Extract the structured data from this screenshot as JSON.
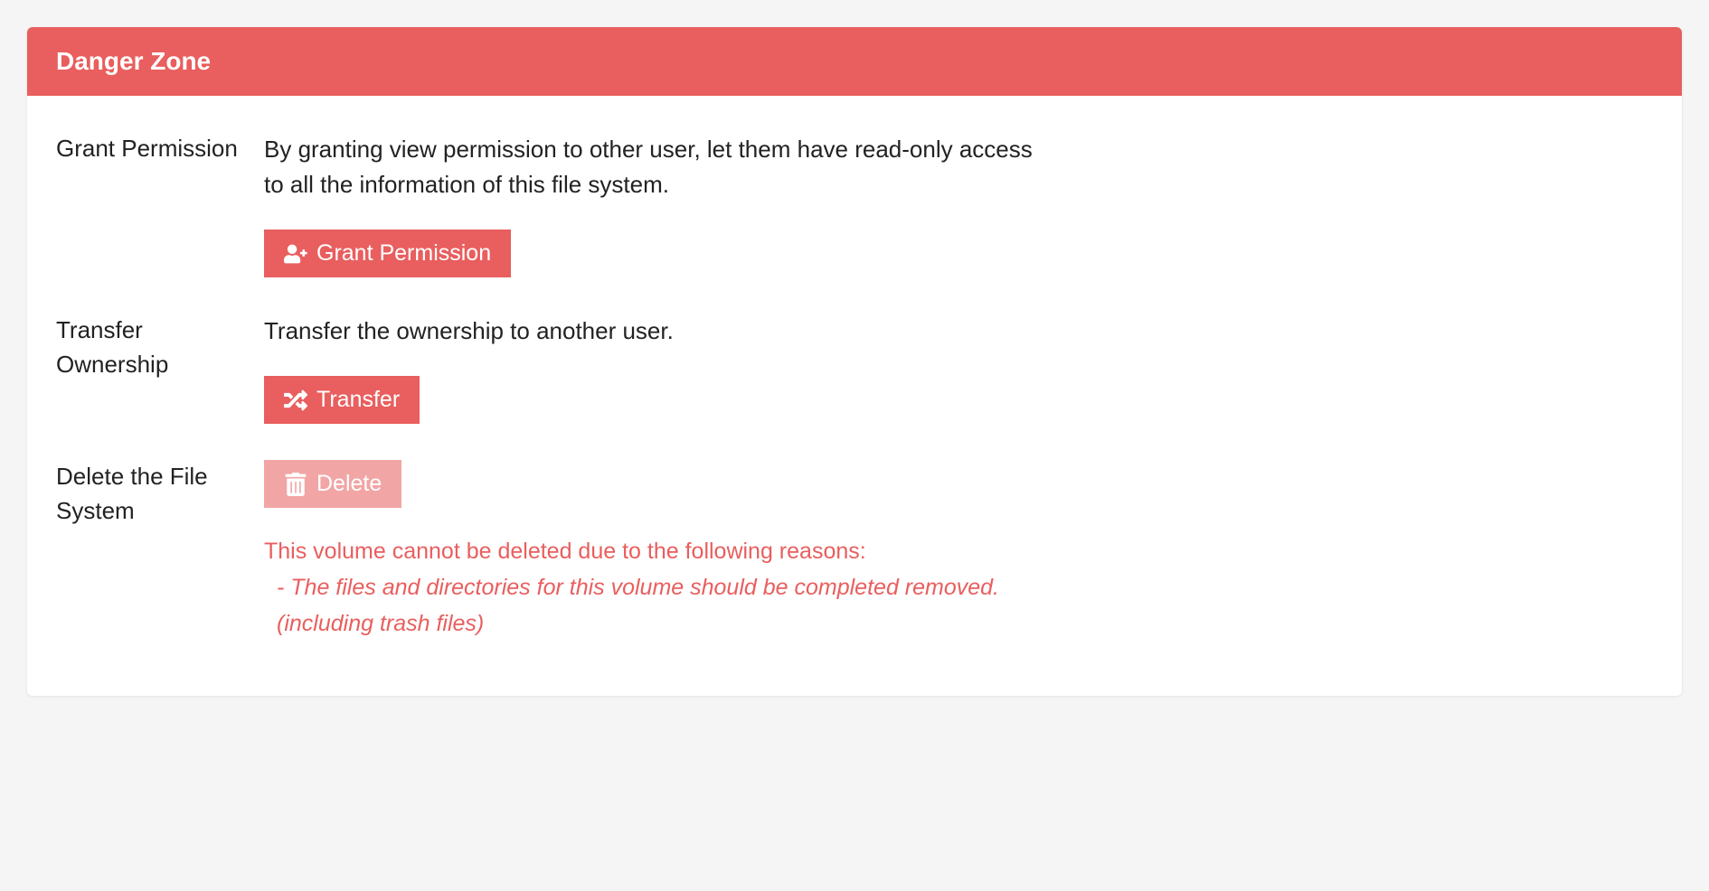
{
  "panel": {
    "title": "Danger Zone"
  },
  "grant": {
    "label": "Grant Permission",
    "description": "By granting view permission to other user, let them have read-only access to all the information of this file system.",
    "button": "Grant Permission"
  },
  "transfer": {
    "label": "Transfer Ownership",
    "description": "Transfer the ownership to another user.",
    "button": "Transfer"
  },
  "delete": {
    "label": "Delete the File System",
    "button": "Delete",
    "warning_intro": "This volume cannot be deleted due to the following reasons:",
    "warning_reason": "  - The files and directories for this volume should be completed removed. (including trash files)"
  }
}
